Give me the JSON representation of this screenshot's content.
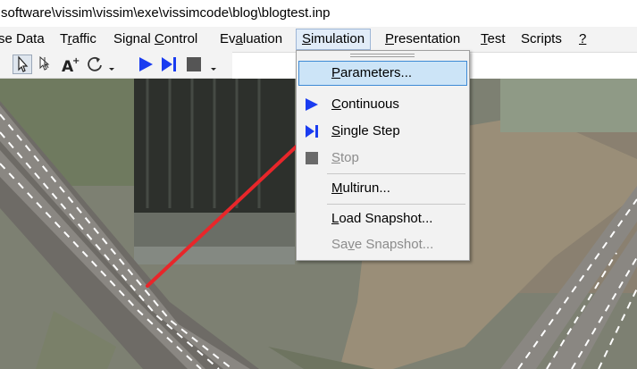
{
  "window": {
    "title": "software\\vissim\\vissim\\exe\\vissimcode\\blog\\blogtest.inp"
  },
  "menubar": {
    "items": [
      {
        "pre": "se Data",
        "ul": "",
        "post": ""
      },
      {
        "pre": "T",
        "ul": "r",
        "post": "affic"
      },
      {
        "pre": "Signal ",
        "ul": "C",
        "post": "ontrol"
      },
      {
        "pre": "Ev",
        "ul": "a",
        "post": "luation"
      },
      {
        "pre": "",
        "ul": "S",
        "post": "imulation"
      },
      {
        "pre": "",
        "ul": "P",
        "post": "resentation"
      },
      {
        "pre": "",
        "ul": "T",
        "post": "est"
      },
      {
        "pre": "Scripts",
        "ul": "",
        "post": ""
      },
      {
        "pre": "",
        "ul": "?",
        "post": ""
      }
    ],
    "active_index": 4
  },
  "toolbar": {
    "buttons": [
      "select-pointer-icon",
      "multi-select-icon",
      "text-size-icon",
      "rotate-icon",
      "chevron-down-icon",
      "play-icon",
      "single-step-icon",
      "stop-icon",
      "chevron-down-icon"
    ]
  },
  "simulation_menu": {
    "items": [
      {
        "pre": "",
        "ul": "P",
        "post": "arameters...",
        "icon": "",
        "enabled": true,
        "highlighted": true
      },
      {
        "pre": "",
        "ul": "C",
        "post": "ontinuous",
        "icon": "play-icon",
        "enabled": true,
        "highlighted": false
      },
      {
        "pre": "",
        "ul": "S",
        "post": "ingle Step",
        "icon": "single-step-icon",
        "enabled": true,
        "highlighted": false
      },
      {
        "pre": "",
        "ul": "S",
        "post": "top",
        "icon": "stop-icon",
        "enabled": false,
        "highlighted": false
      },
      {
        "pre": "",
        "ul": "M",
        "post": "ultirun...",
        "icon": "",
        "enabled": true,
        "highlighted": false
      },
      {
        "pre": "",
        "ul": "L",
        "post": "oad Snapshot...",
        "icon": "",
        "enabled": true,
        "highlighted": false
      },
      {
        "pre": "Sa",
        "ul": "v",
        "post": "e Snapshot...",
        "icon": "",
        "enabled": false,
        "highlighted": false
      }
    ]
  },
  "annotation": {
    "arrow_color": "#e8262a"
  },
  "colors": {
    "accent_blue": "#1a3cf0",
    "highlight_bg": "#cce4f7",
    "highlight_border": "#3e8ad5",
    "disabled_text": "#8c8c8c"
  }
}
